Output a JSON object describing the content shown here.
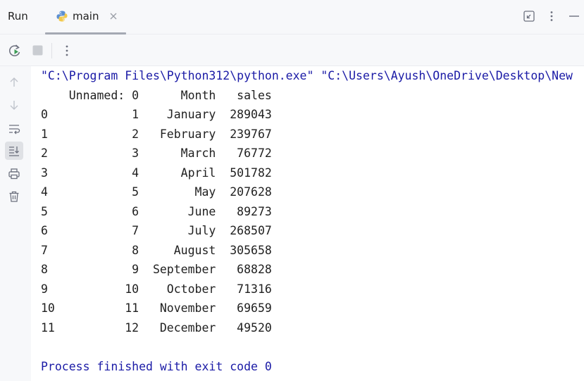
{
  "header": {
    "title": "Run",
    "tab": {
      "label": "main"
    }
  },
  "icons": {
    "python": "python-icon",
    "close": "close-icon",
    "restore": "restore-icon",
    "more": "more-vertical-icon",
    "minimize": "minimize-icon",
    "rerun": "rerun-icon",
    "stop": "stop-icon",
    "up": "arrow-up-icon",
    "down": "arrow-down-icon",
    "wrap": "soft-wrap-icon",
    "scroll_end": "scroll-to-end-icon",
    "print": "print-icon",
    "trash": "trash-icon"
  },
  "colors": {
    "command": "#1a1aa6",
    "exit": "#1a1aa6",
    "text": "#1f1f1f",
    "rerun_green": "#3d9c57"
  },
  "console": {
    "lines": [
      "\"C:\\Program Files\\Python312\\python.exe\" \"C:\\Users\\Ayush\\OneDrive\\Desktop\\New",
      "    Unnamed: 0      Month   sales",
      "0            1    January  289043",
      "1            2   February  239767",
      "2            3      March   76772",
      "3            4      April  501782",
      "4            5        May  207628",
      "5            6       June   89273",
      "6            7       July  268507",
      "7            8     August  305658",
      "8            9  September   68828",
      "9           10    October   71316",
      "10          11   November   69659",
      "11          12   December   49520",
      "",
      "Process finished with exit code 0"
    ]
  }
}
